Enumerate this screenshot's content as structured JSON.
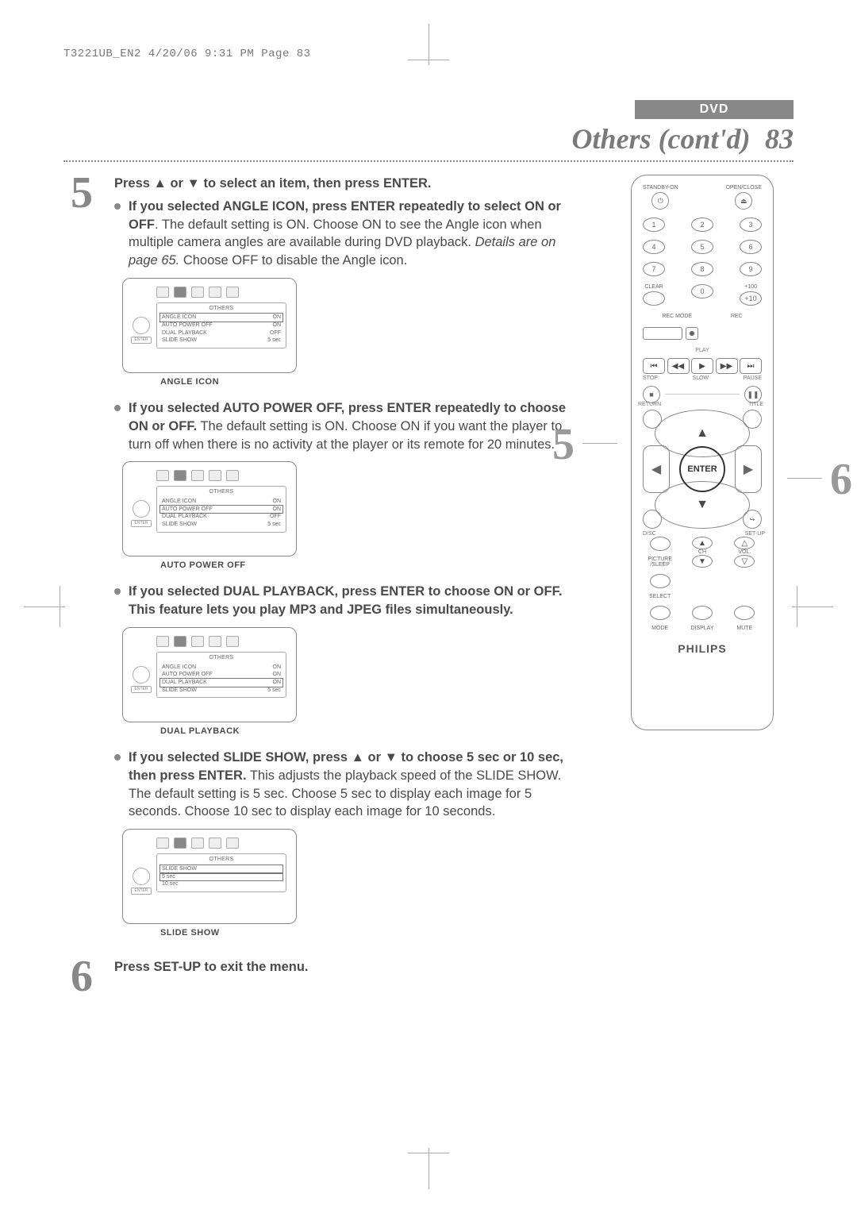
{
  "print_header": "T3221UB_EN2  4/20/06  9:31 PM  Page 83",
  "dvd_label": "DVD",
  "page_title": "Others (cont'd)",
  "page_number": "83",
  "step5": {
    "number": "5",
    "lead": "Press ▲ or ▼ to select an item, then press ENTER.",
    "angle": {
      "bold": "If you selected ANGLE ICON, press ENTER repeatedly to select ON or OFF",
      "rest": ".  The default setting is ON. Choose ON to see the Angle icon when multiple camera angles are available during DVD playback. ",
      "italic": "Details are on page 65.",
      "rest2": " Choose OFF to disable the Angle icon.",
      "caption": "ANGLE ICON"
    },
    "auto": {
      "bold": "If you selected AUTO POWER OFF, press ENTER repeatedly to choose ON or OFF.",
      "rest": " The default setting is ON. Choose ON if you want the player to turn off when there is no activity at the player or its remote for 20 minutes.",
      "caption": "AUTO POWER OFF"
    },
    "dual": {
      "bold": "If you selected DUAL PLAYBACK, press ENTER to choose ON or OFF.  This feature lets you play MP3 and JPEG files simultaneously.",
      "caption": "DUAL PLAYBACK"
    },
    "slide": {
      "bold": "If you selected SLIDE SHOW, press ▲ or ▼ to choose 5 sec or 10 sec, then press ENTER.",
      "rest": " This adjusts the playback speed of the SLIDE SHOW. The default setting is 5 sec. Choose 5 sec to display each image for 5 seconds. Choose 10 sec to display each image for 10 seconds.",
      "caption": "SLIDE SHOW"
    }
  },
  "step6": {
    "number": "6",
    "text": "Press SET-UP to exit the menu."
  },
  "osd": {
    "section_title": "OTHERS",
    "rows_main": [
      {
        "k": "ANGLE ICON",
        "v": "ON"
      },
      {
        "k": "AUTO POWER OFF",
        "v": "ON"
      },
      {
        "k": "DUAL PLAYBACK",
        "v": "OFF"
      },
      {
        "k": "SLIDE SHOW",
        "v": "5 sec"
      }
    ],
    "rows_dual": [
      {
        "k": "ANGLE ICON",
        "v": "ON"
      },
      {
        "k": "AUTO POWER OFF",
        "v": "ON"
      },
      {
        "k": "DUAL PLAYBACK",
        "v": "ON"
      },
      {
        "k": "SLIDE SHOW",
        "v": "5 sec"
      }
    ],
    "rows_slide_a": [
      {
        "k": "SLIDE SHOW",
        "v": ""
      },
      {
        "k": "5 sec",
        "v": ""
      },
      {
        "k": "10 sec",
        "v": ""
      }
    ],
    "enter": "ENTER"
  },
  "remote": {
    "standby": "STANDBY-ON",
    "openclose": "OPEN/CLOSE",
    "digits": [
      "1",
      "2",
      "3",
      "4",
      "5",
      "6",
      "7",
      "8",
      "9",
      "0"
    ],
    "clear": "CLEAR",
    "plus100": "+100",
    "plus10": "+10",
    "recmode": "REC MODE",
    "rec": "REC",
    "play": "PLAY",
    "stop": "STOP",
    "slow": "SLOW",
    "pause": "PAUSE",
    "return": "RETURN",
    "title": "TITLE",
    "disc": "DISC",
    "setup": "SET-UP",
    "enter": "ENTER",
    "picture_sleep": "PICTURE /SLEEP",
    "ch": "CH",
    "vol": "VOL.",
    "select": "SELECT",
    "mode": "MODE",
    "display": "DISPLAY",
    "mute": "MUTE",
    "brand": "PHILIPS",
    "ref5": "5",
    "ref6": "6"
  }
}
